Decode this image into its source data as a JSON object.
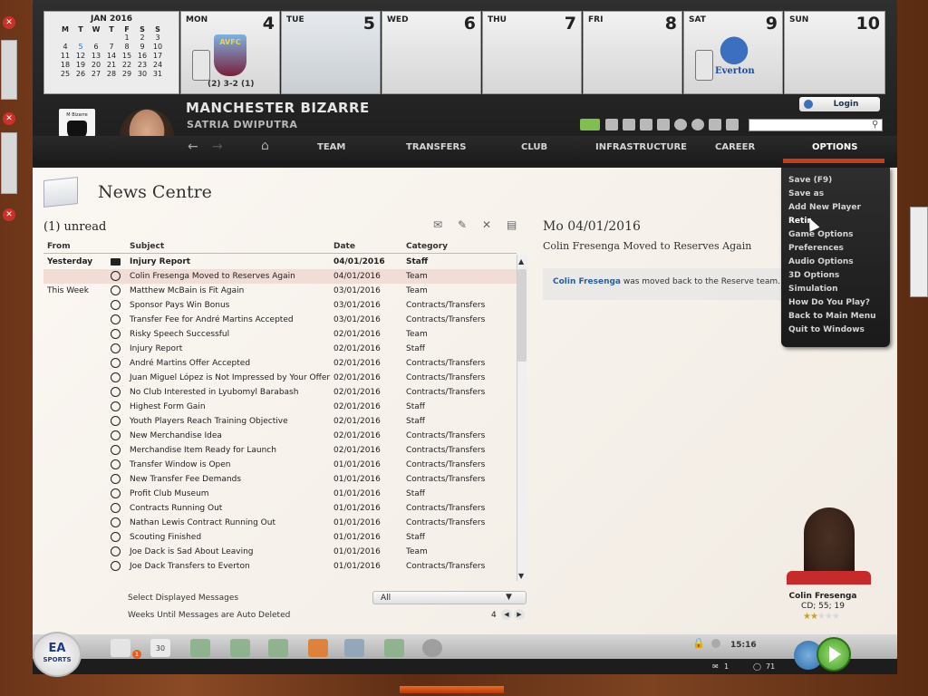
{
  "calendar": {
    "month_title": "JAN 2016",
    "weekdays": [
      "M",
      "T",
      "W",
      "T",
      "F",
      "S",
      "S"
    ],
    "weeks": [
      [
        "",
        "",
        "",
        "",
        "1",
        "2",
        "3"
      ],
      [
        "4",
        "5",
        "6",
        "7",
        "8",
        "9",
        "10"
      ],
      [
        "11",
        "12",
        "13",
        "14",
        "15",
        "16",
        "17"
      ],
      [
        "18",
        "19",
        "20",
        "21",
        "22",
        "23",
        "24"
      ],
      [
        "25",
        "26",
        "27",
        "28",
        "29",
        "30",
        "31"
      ]
    ],
    "days": [
      {
        "name": "MON",
        "num": "4",
        "result": "(2) 3-2 (1)",
        "crest_text": "AVFC"
      },
      {
        "name": "TUE",
        "num": "5"
      },
      {
        "name": "WED",
        "num": "6"
      },
      {
        "name": "THU",
        "num": "7"
      },
      {
        "name": "FRI",
        "num": "8"
      },
      {
        "name": "SAT",
        "num": "9",
        "crest_text": "Everton"
      },
      {
        "name": "SUN",
        "num": "10"
      }
    ]
  },
  "header": {
    "club_name": "MANCHESTER BIZARRE",
    "badge_text": "M Bizarre",
    "manager_name": "SATRIA DWIPUTRA",
    "login_label": "Login",
    "search_placeholder": ""
  },
  "nav": {
    "items": [
      "TEAM",
      "TRANSFERS",
      "CLUB",
      "INFRASTRUCTURE",
      "CAREER",
      "OPTIONS"
    ]
  },
  "options_menu": [
    "Save (F9)",
    "Save as",
    "Add New Player",
    "Retir",
    "Game Options",
    "Preferences",
    "Audio Options",
    "3D Options",
    "Simulation",
    "How Do You Play?",
    "Back to Main Menu",
    "Quit to Windows"
  ],
  "news": {
    "title": "News Centre",
    "unread_label": "(1) unread",
    "columns": [
      "From",
      "Subject",
      "Date",
      "Category"
    ],
    "rows": [
      {
        "from": "Yesterday",
        "subject": "Injury Report",
        "date": "04/01/2016",
        "category": "Staff",
        "bold": true,
        "icon": "envelope"
      },
      {
        "from": "",
        "subject": "Colin Fresenga Moved to Reserves Again",
        "date": "04/01/2016",
        "category": "Team",
        "selected": true,
        "icon": "read"
      },
      {
        "from": "This Week",
        "subject": "Matthew McBain is Fit Again",
        "date": "03/01/2016",
        "category": "Team",
        "icon": "read"
      },
      {
        "from": "",
        "subject": "Sponsor Pays Win Bonus",
        "date": "03/01/2016",
        "category": "Contracts/Transfers",
        "icon": "read"
      },
      {
        "from": "",
        "subject": "Transfer Fee for André Martins Accepted",
        "date": "03/01/2016",
        "category": "Contracts/Transfers",
        "icon": "read"
      },
      {
        "from": "",
        "subject": "Risky Speech Successful",
        "date": "02/01/2016",
        "category": "Team",
        "icon": "read"
      },
      {
        "from": "",
        "subject": "Injury Report",
        "date": "02/01/2016",
        "category": "Staff",
        "icon": "read"
      },
      {
        "from": "",
        "subject": "André Martins Offer Accepted",
        "date": "02/01/2016",
        "category": "Contracts/Transfers",
        "icon": "read"
      },
      {
        "from": "",
        "subject": "Juan Miguel López is Not Impressed by Your Offer",
        "date": "02/01/2016",
        "category": "Contracts/Transfers",
        "icon": "read"
      },
      {
        "from": "",
        "subject": "No Club Interested in Lyubomyl Barabash",
        "date": "02/01/2016",
        "category": "Contracts/Transfers",
        "icon": "read"
      },
      {
        "from": "",
        "subject": "Highest Form Gain",
        "date": "02/01/2016",
        "category": "Staff",
        "icon": "read"
      },
      {
        "from": "",
        "subject": "Youth Players Reach Training Objective",
        "date": "02/01/2016",
        "category": "Staff",
        "icon": "read"
      },
      {
        "from": "",
        "subject": "New Merchandise Idea",
        "date": "02/01/2016",
        "category": "Contracts/Transfers",
        "icon": "read"
      },
      {
        "from": "",
        "subject": "Merchandise Item Ready for Launch",
        "date": "02/01/2016",
        "category": "Contracts/Transfers",
        "icon": "read"
      },
      {
        "from": "",
        "subject": "Transfer Window is Open",
        "date": "01/01/2016",
        "category": "Contracts/Transfers",
        "icon": "read"
      },
      {
        "from": "",
        "subject": "New Transfer Fee Demands",
        "date": "01/01/2016",
        "category": "Contracts/Transfers",
        "icon": "read"
      },
      {
        "from": "",
        "subject": "Profit Club Museum",
        "date": "01/01/2016",
        "category": "Staff",
        "icon": "read"
      },
      {
        "from": "",
        "subject": "Contracts Running Out",
        "date": "01/01/2016",
        "category": "Contracts/Transfers",
        "icon": "read"
      },
      {
        "from": "",
        "subject": "Nathan Lewis Contract Running Out",
        "date": "01/01/2016",
        "category": "Contracts/Transfers",
        "icon": "read"
      },
      {
        "from": "",
        "subject": "Scouting Finished",
        "date": "01/01/2016",
        "category": "Staff",
        "icon": "read"
      },
      {
        "from": "",
        "subject": "Joe Dack is Sad About Leaving",
        "date": "01/01/2016",
        "category": "Team",
        "icon": "read"
      },
      {
        "from": "",
        "subject": "Joe Dack Transfers to Everton",
        "date": "01/01/2016",
        "category": "Contracts/Transfers",
        "icon": "read"
      }
    ],
    "filter_label": "Select Displayed Messages",
    "filter_value": "All",
    "weeks_label": "Weeks Until Messages are Auto Deleted",
    "weeks_value": "4"
  },
  "detail": {
    "date": "Mo 04/01/2016",
    "subject": "Colin Fresenga Moved to Reserves Again",
    "body_name": "Colin Fresenga",
    "body_rest": " was moved back to the Reserve team."
  },
  "player_card": {
    "name": "Colin Fresenga",
    "info": "CD; 55; 19",
    "stars": 2,
    "stars_max": 5
  },
  "bottom_bar": {
    "ea_label": "EA",
    "ea_sub": "SPORTS",
    "mail_badge": "1",
    "calendar_icon_num": "30",
    "time": "15:16",
    "mail_count": "1",
    "msg_count": "71"
  },
  "colors": {
    "accent": "#c83c1e",
    "link": "#2a5e9a",
    "selected_row": "#f1dcd6",
    "play_green": "#3f9a20"
  }
}
